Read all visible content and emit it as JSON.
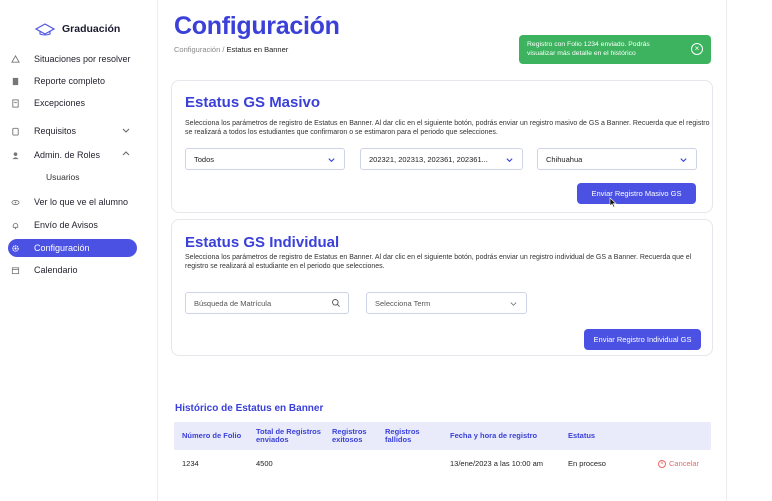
{
  "sidebar": {
    "brand": "Graduación",
    "items": [
      {
        "label": "Situaciones por resolver",
        "icon": "alert-icon"
      },
      {
        "label": "Reporte completo",
        "icon": "document-icon"
      },
      {
        "label": "Excepciones",
        "icon": "file-icon"
      },
      {
        "label": "Requisitos",
        "icon": "clipboard-icon"
      },
      {
        "label": "Admin. de Roles",
        "icon": "person-icon"
      },
      {
        "label": "Usuarios",
        "icon": ""
      },
      {
        "label": "Ver lo que ve el alumno",
        "icon": "eye-icon"
      },
      {
        "label": "Envío de Avisos",
        "icon": "bell-icon"
      },
      {
        "label": "Configuración",
        "icon": "gear-icon"
      },
      {
        "label": "Calendario",
        "icon": "calendar-icon"
      }
    ]
  },
  "header": {
    "title": "Configuración",
    "breadcrumb_root": "Configuración",
    "breadcrumb_sep": " / ",
    "breadcrumb_current": "Estatus en Banner"
  },
  "toast": {
    "message": "Registro con Folio 1234 enviado. Podrás visualizar más detalle en el histórico",
    "color": "#3db35f"
  },
  "masivo": {
    "title": "Estatus GS Masivo",
    "description": "Selecciona los parámetros de registro de Estatus en Banner. Al dar clic en el siguiente botón, podrás enviar un registro masivo de GS a Banner. Recuerda que el registro se realizará a todos los estudiantes que confirmaron o se estimaron para el periodo que selecciones.",
    "select1": "Todos",
    "select2": "202321, 202313, 202361, 202361...",
    "select3": "Chihuahua",
    "button": "Enviar Registro Masivo GS"
  },
  "individual": {
    "title": "Estatus GS Individual",
    "description": "Selecciona los parámetros de registro de Estatus en Banner. Al dar clic en el siguiente botón, podrás enviar un registro individual de GS a Banner. Recuerda que el registro se realizará al estudiante en el periodo que selecciones.",
    "search_placeholder": "Búsqueda de Matrícula",
    "term_placeholder": "Selecciona Term",
    "button": "Enviar Registro Individual GS"
  },
  "history": {
    "title": "Histórico de Estatus en Banner",
    "columns": [
      "Número de Folio",
      "Total de Registros enviados",
      "Registros exitosos",
      "Registros fallidos",
      "Fecha y hora de registro",
      "Estatus"
    ],
    "rows": [
      {
        "folio": "1234",
        "total": "4500",
        "exitosos": "",
        "fallidos": "",
        "fecha": "13/ene/2023 a las 10:00 am",
        "estatus": "En proceso",
        "action": "Cancelar"
      }
    ]
  },
  "colors": {
    "accent": "#3a40d8",
    "active_nav": "#4b52e3",
    "success": "#3db35f",
    "danger": "#e86b6b"
  }
}
